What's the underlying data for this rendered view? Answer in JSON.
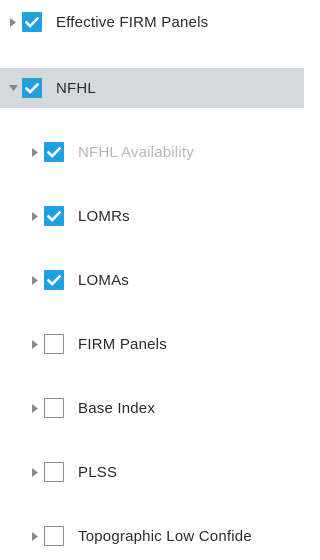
{
  "colors": {
    "accent": "#1fa0e0",
    "selected_row_bg": "#d6d9db",
    "muted_text": "#b7b7b7"
  },
  "layers": [
    {
      "label": "Effective FIRM Panels",
      "checked": true,
      "expanded": false
    },
    {
      "label": "NFHL",
      "checked": true,
      "expanded": true,
      "selected": true
    },
    {
      "label": "NFHL Availability",
      "checked": true,
      "expanded": false,
      "muted": true
    },
    {
      "label": "LOMRs",
      "checked": true,
      "expanded": false
    },
    {
      "label": "LOMAs",
      "checked": true,
      "expanded": false
    },
    {
      "label": "FIRM Panels",
      "checked": false,
      "expanded": false
    },
    {
      "label": "Base Index",
      "checked": false,
      "expanded": false
    },
    {
      "label": "PLSS",
      "checked": false,
      "expanded": false
    },
    {
      "label": "Topographic Low Confide",
      "checked": false,
      "expanded": false
    }
  ],
  "icons": {
    "collapsed": "caret-right-icon",
    "expanded": "caret-down-icon",
    "checked": "checkmark-icon"
  }
}
